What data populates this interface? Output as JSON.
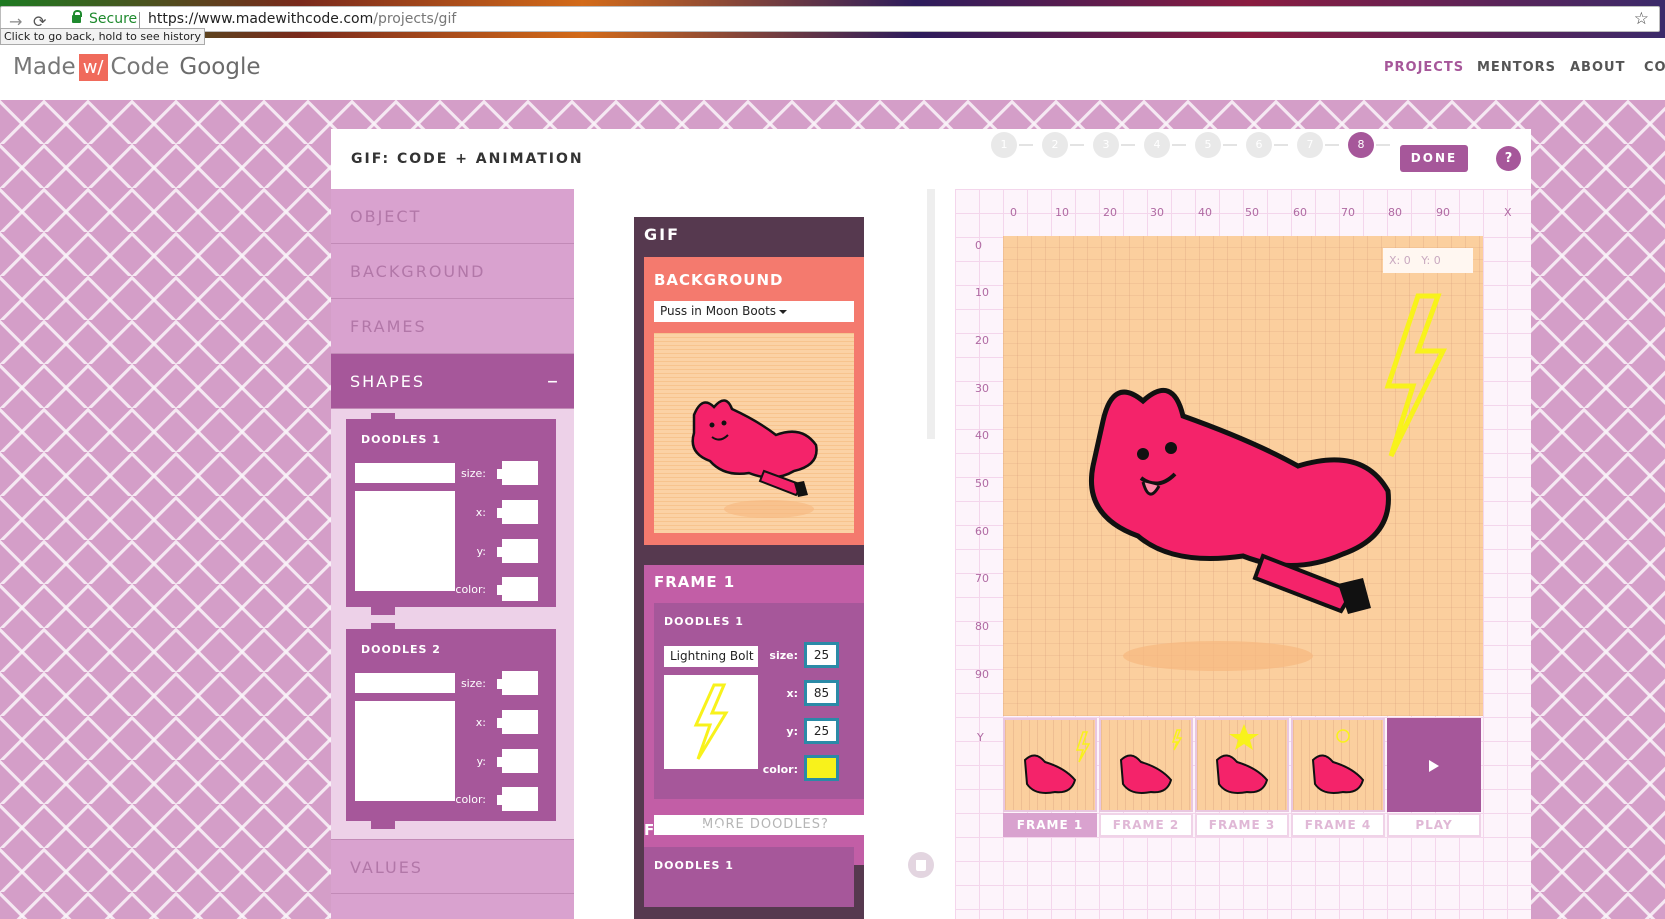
{
  "browser": {
    "secure_label": "Secure",
    "url_host": "https://www.madewithcode.com",
    "url_path": "/projects/gif",
    "tooltip": "Click to go back, hold to see history"
  },
  "site": {
    "logo_made": "Made",
    "logo_w": "w/",
    "logo_code": "Code",
    "logo_google": "Google",
    "nav": [
      "PROJECTS",
      "MENTORS",
      "ABOUT",
      "CO"
    ],
    "nav_active_color": "#a6579a"
  },
  "project": {
    "title": "GIF: CODE + ANIMATION",
    "steps": [
      "1",
      "2",
      "3",
      "4",
      "5",
      "6",
      "7",
      "8"
    ],
    "active_step": "8",
    "done_label": "DONE",
    "help_label": "?"
  },
  "menu": {
    "items": [
      "OBJECT",
      "BACKGROUND",
      "FRAMES",
      "SHAPES",
      "VALUES"
    ],
    "active": "SHAPES",
    "collapse_symbol": "–",
    "doodles": [
      {
        "title": "DOODLES 1",
        "size_label": "size:",
        "x_label": "x:",
        "y_label": "y:",
        "color_label": "color:"
      },
      {
        "title": "DOODLES 2",
        "size_label": "size:",
        "x_label": "x:",
        "y_label": "y:",
        "color_label": "color:"
      }
    ]
  },
  "code": {
    "gif_label": "GIF",
    "background_label": "BACKGROUND",
    "background_value": "Puss in Moon Boots",
    "frame1_label": "FRAME 1",
    "frame1_doodle_title": "DOODLES 1",
    "doodle_shape": "Lightning Bolt",
    "size_label": "size:",
    "size_value": "25",
    "x_label": "x:",
    "x_value": "85",
    "y_label": "y:",
    "y_value": "25",
    "color_label": "color:",
    "color_value": "#f8f21b",
    "more_doodles": "MORE DOODLES?",
    "frame2_label": "FRAME 2",
    "frame2_doodle_title": "DOODLES 1"
  },
  "canvas": {
    "x_ticks": [
      "0",
      "10",
      "20",
      "30",
      "40",
      "50",
      "60",
      "70",
      "80",
      "90",
      "X"
    ],
    "y_ticks": [
      "0",
      "10",
      "20",
      "30",
      "40",
      "50",
      "60",
      "70",
      "80",
      "90",
      "Y"
    ],
    "coord_x": "X: 0",
    "coord_y": "Y: 0",
    "frames": [
      "FRAME 1",
      "FRAME 2",
      "FRAME 3",
      "FRAME 4",
      "PLAY"
    ],
    "active_frame": "FRAME 1"
  }
}
